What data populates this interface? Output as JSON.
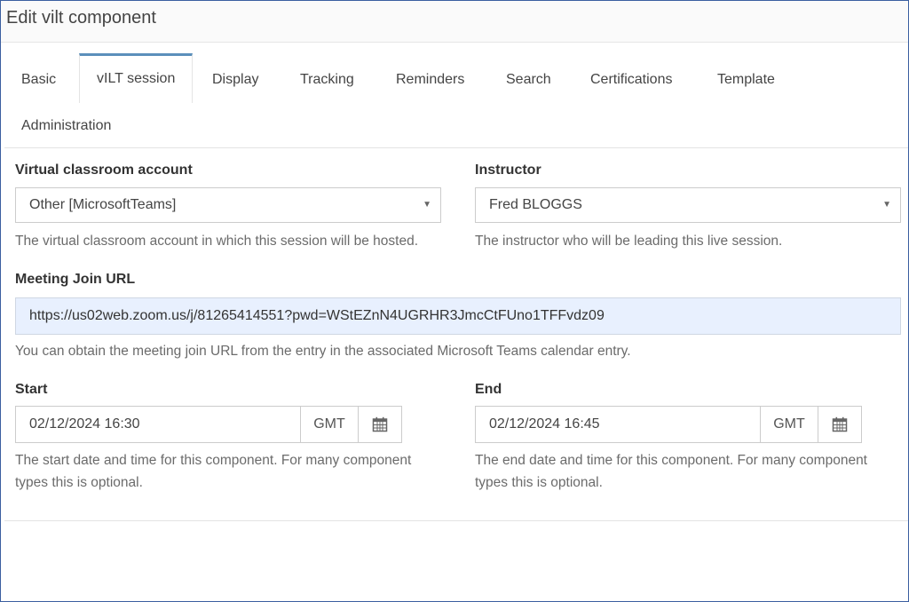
{
  "window": {
    "title": "Edit vilt component"
  },
  "tabs": [
    {
      "label": "Basic"
    },
    {
      "label": "vILT session"
    },
    {
      "label": "Display"
    },
    {
      "label": "Tracking"
    },
    {
      "label": "Reminders"
    },
    {
      "label": "Search"
    },
    {
      "label": "Certifications"
    },
    {
      "label": "Template"
    },
    {
      "label": "Administration"
    }
  ],
  "active_tab": "vILT session",
  "form": {
    "account": {
      "label": "Virtual classroom account",
      "value": "Other [MicrosoftTeams]",
      "help": "The virtual classroom account in which this session will be hosted."
    },
    "instructor": {
      "label": "Instructor",
      "value": "Fred BLOGGS",
      "help": "The instructor who will be leading this live session."
    },
    "meeting_url": {
      "label": "Meeting Join URL",
      "value": "https://us02web.zoom.us/j/81265414551?pwd=WStEZnN4UGRHR3JmcCtFUno1TFFvdz09",
      "help": "You can obtain the meeting join URL from the entry in the associated Microsoft Teams calendar entry."
    },
    "start": {
      "label": "Start",
      "value": "02/12/2024 16:30",
      "timezone": "GMT",
      "help_line1": "The start date and time for this component. For many component",
      "help_line2": "types this is optional."
    },
    "end": {
      "label": "End",
      "value": "02/12/2024 16:45",
      "timezone": "GMT",
      "help_line1": "The end date and time for this component. For many component",
      "help_line2": "types this is optional."
    }
  },
  "icons": {
    "caret": "caret-down-icon",
    "calendar": "calendar-icon"
  },
  "colors": {
    "active_tab_accent": "#5b8fbb",
    "url_field_bg": "#e8f0fe",
    "frame_border": "#3b5fa0"
  }
}
